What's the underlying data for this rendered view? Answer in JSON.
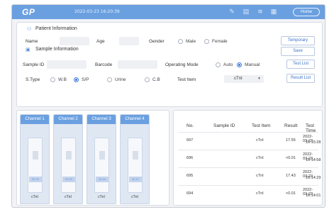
{
  "topbar": {
    "logo": "GP",
    "datetime": "2022-03-23 16:20:39",
    "icons": [
      "pen-icon",
      "printer-icon",
      "wifi-icon",
      "grid-icon"
    ],
    "home_label": "Home"
  },
  "patient": {
    "section_title": "Patient Information",
    "name_label": "Name",
    "name_value": "",
    "age_label": "Age",
    "age_value": "",
    "gender_label": "Gender",
    "gender_options": [
      "Male",
      "Female"
    ],
    "gender_selected": "",
    "temporary_label": "Temporary",
    "save_label": "Save"
  },
  "sample": {
    "section_title": "Sample Information",
    "sample_id_label": "Sample ID",
    "sample_id_value": "",
    "barcode_label": "Barcode",
    "barcode_value": "",
    "operating_mode_label": "Operating Mode",
    "mode_options": [
      "Auto",
      "Manual"
    ],
    "mode_selected": "Manual",
    "test_list_label": "Test List",
    "stype_label": "S.Type",
    "stype_options": [
      "W.B",
      "S/P",
      "Urine",
      "C.B"
    ],
    "stype_selected": "S/P",
    "test_item_label": "Test Item",
    "test_item_value": "cTnI",
    "result_list_label": "Result List"
  },
  "channels": [
    {
      "label": "Channel 1",
      "cart_label": "03-22",
      "item": "cTnI"
    },
    {
      "label": "Channel 2",
      "cart_label": "03-23",
      "item": "cTnI"
    },
    {
      "label": "Channel 3",
      "cart_label": "03-24",
      "item": "cTnI"
    },
    {
      "label": "Channel 4",
      "cart_label": "03-27",
      "item": "cTnI"
    }
  ],
  "results": {
    "headers": [
      "No.",
      "Sample ID",
      "Test Item",
      "Result",
      "Test Time"
    ],
    "rows": [
      {
        "no": "697",
        "sample_id": "",
        "test_item": "cTnI",
        "result": "17.55",
        "date": "2022-03-23",
        "time": "16:15:28"
      },
      {
        "no": "696",
        "sample_id": "",
        "test_item": "cTnI",
        "result": "<0.01",
        "date": "2022-03-23",
        "time": "16:14:58"
      },
      {
        "no": "695",
        "sample_id": "",
        "test_item": "cTnI",
        "result": "17.43",
        "date": "2022-03-23",
        "time": "16:14:29"
      },
      {
        "no": "694",
        "sample_id": "",
        "test_item": "cTnI",
        "result": "<0.01",
        "date": "2022-03-23",
        "time": "16:14:01"
      }
    ]
  },
  "colors": {
    "accent": "#6aa0e0",
    "button_text": "#3b73c6",
    "radio_on": "#3b7bdc"
  }
}
